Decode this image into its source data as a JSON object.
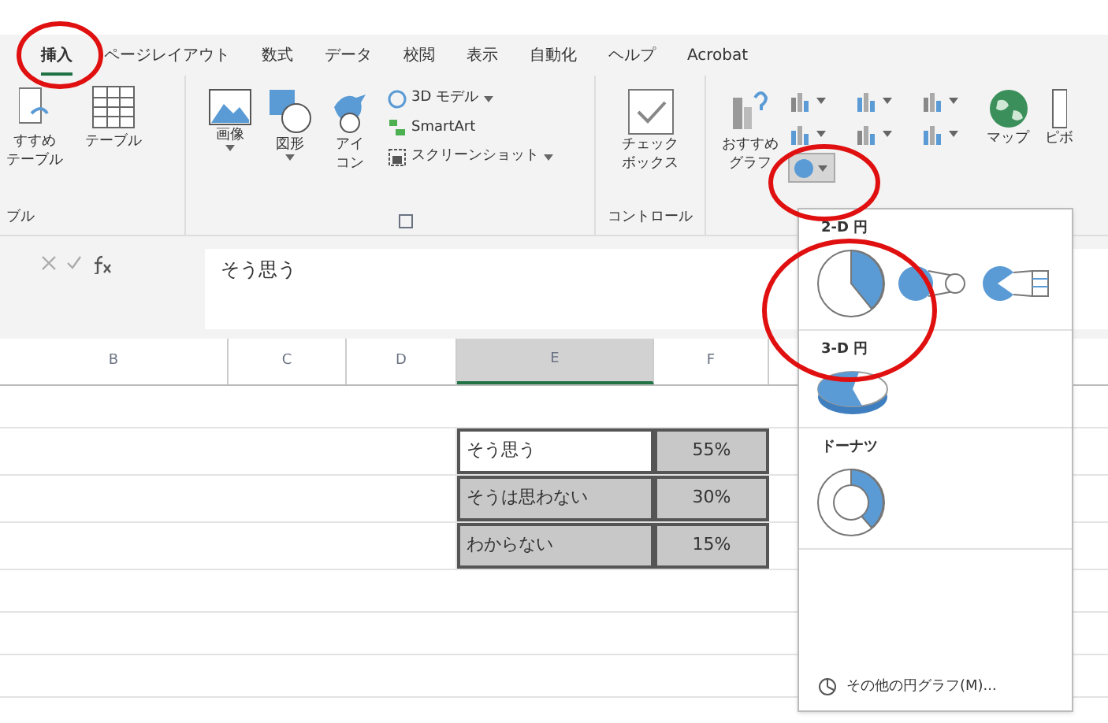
{
  "tabs": [
    {
      "label": "挿入",
      "selected": true
    },
    {
      "label": "ページレイアウト",
      "selected": false
    },
    {
      "label": "数式",
      "selected": false
    },
    {
      "label": "データ",
      "selected": false
    },
    {
      "label": "校閲",
      "selected": false
    },
    {
      "label": "表示",
      "selected": false
    },
    {
      "label": "自動化",
      "selected": false
    },
    {
      "label": "ヘルプ",
      "selected": false
    },
    {
      "label": "Acrobat",
      "selected": false
    }
  ],
  "ribbon": {
    "tables_group": {
      "items": [
        {
          "kind": "cut",
          "lines": [
            "すすめ",
            "テーブル"
          ]
        },
        {
          "kind": "table",
          "lines": [
            "テーブル"
          ]
        }
      ],
      "label": "ブル"
    },
    "illustrations_group": {
      "items": [
        {
          "kind": "image",
          "lines": [
            "画像"
          ],
          "dropdown": true
        },
        {
          "kind": "shapes",
          "lines": [
            "図形"
          ],
          "dropdown": true
        },
        {
          "kind": "icons",
          "lines": [
            "アイ",
            "コン"
          ],
          "dropdown": false
        }
      ],
      "small_items": [
        {
          "kind": "model3d",
          "label": "3D モデル",
          "dropdown": true
        },
        {
          "kind": "smartart",
          "label": "SmartArt",
          "dropdown": false
        },
        {
          "kind": "screenshot",
          "label": "スクリーンショット",
          "dropdown": true
        }
      ]
    },
    "controls_group": {
      "items": [
        {
          "kind": "checkbox",
          "lines": [
            "チェック",
            "ボックス"
          ]
        }
      ],
      "label": "コントロール"
    },
    "charts_group": {
      "recommended": [
        "おすすめ",
        "グラフ"
      ],
      "map": [
        "マップ"
      ],
      "pivot": [
        "ピボ"
      ]
    }
  },
  "formula_bar": {
    "value": "そう思う"
  },
  "columns": [
    {
      "label": "B",
      "selected": false
    },
    {
      "label": "C",
      "selected": false
    },
    {
      "label": "D",
      "selected": false
    },
    {
      "label": "E",
      "selected": true
    },
    {
      "label": "F",
      "selected": false
    }
  ],
  "table": [
    {
      "label": "そう思う",
      "value": "55%",
      "active": true
    },
    {
      "label": "そうは思わない",
      "value": "30%",
      "active": false
    },
    {
      "label": "わからない",
      "value": "15%",
      "active": false
    }
  ],
  "pie_menu": {
    "sections": [
      {
        "title": "2-D 円",
        "options": [
          {
            "kind": "pie"
          },
          {
            "kind": "pie-of-pie"
          },
          {
            "kind": "bar-of-pie"
          }
        ]
      },
      {
        "title": "3-D 円",
        "options": [
          {
            "kind": "pie-3d"
          }
        ]
      },
      {
        "title": "ドーナツ",
        "options": [
          {
            "kind": "doughnut"
          }
        ]
      }
    ],
    "footer": "その他の円グラフ(M)..."
  }
}
